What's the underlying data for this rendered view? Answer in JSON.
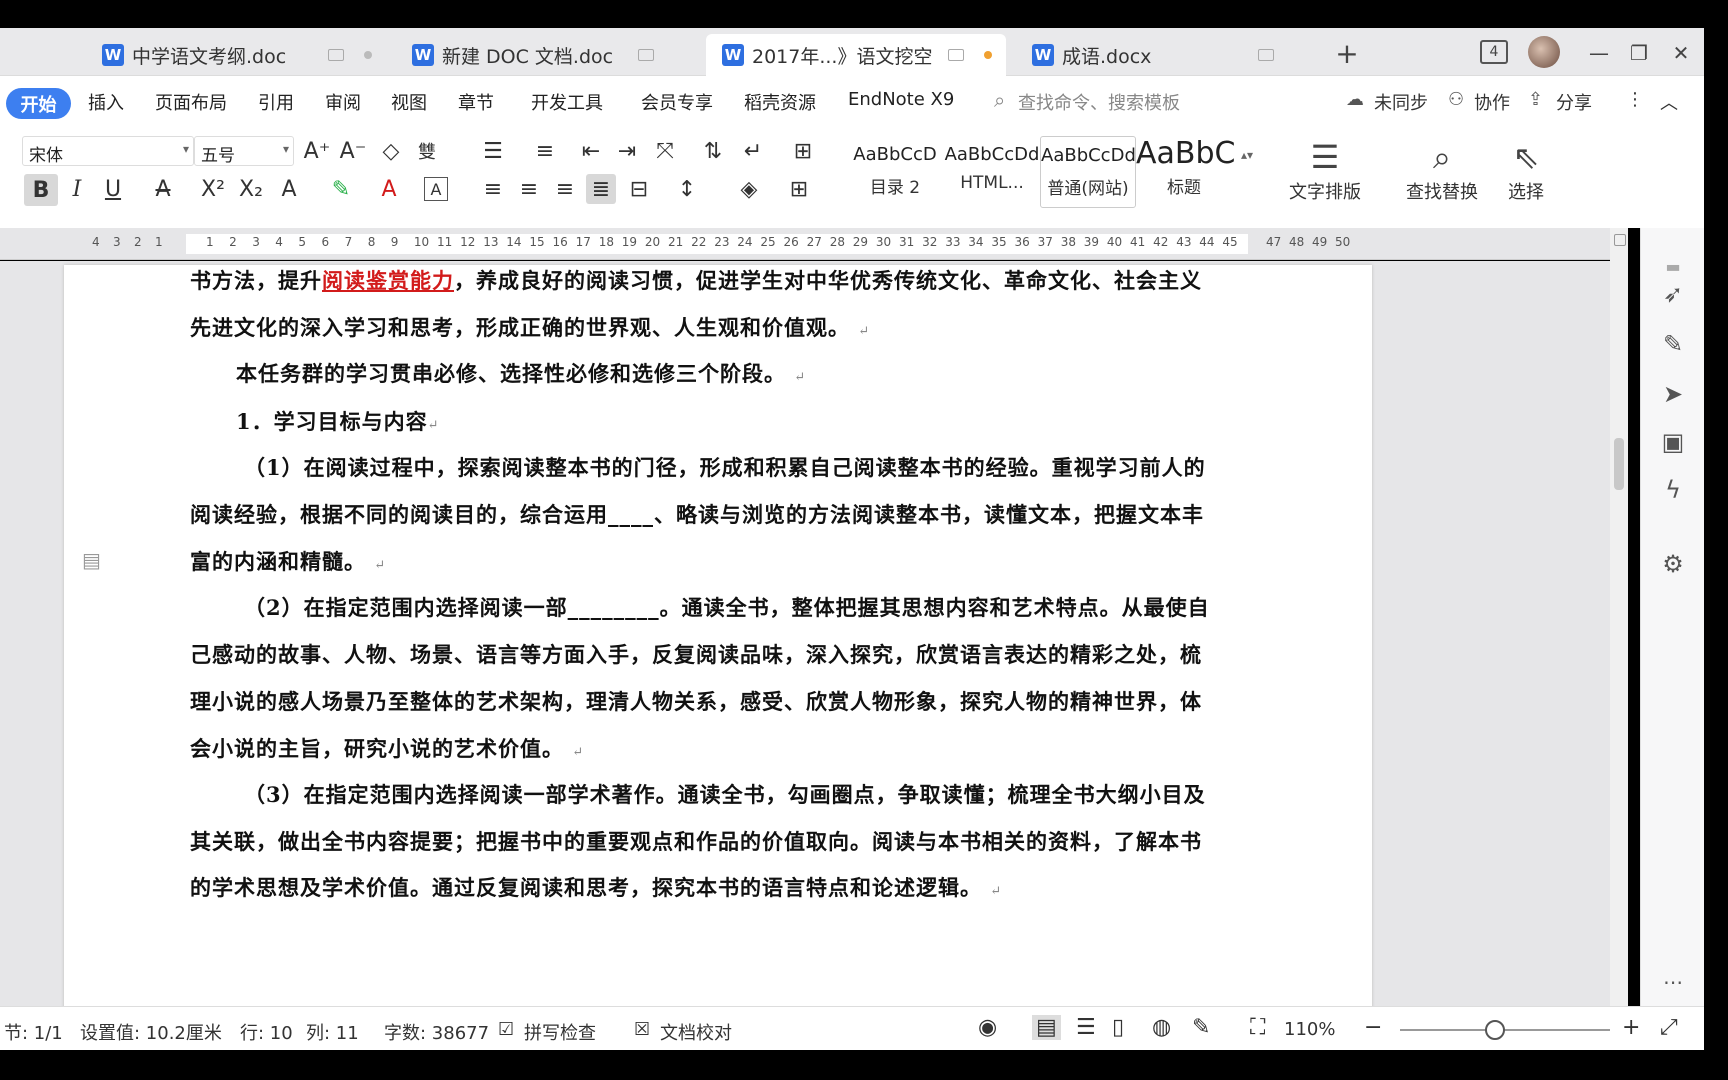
{
  "tabs": [
    {
      "label": "中学语文考纲.doc",
      "active": false,
      "modified": false
    },
    {
      "label": "新建 DOC 文档.doc",
      "active": false,
      "modified": false
    },
    {
      "label": "2017年...》语文挖空",
      "active": true,
      "modified": true
    },
    {
      "label": "成语.docx",
      "active": false,
      "modified": false
    }
  ],
  "window": {
    "new_tab": "+",
    "win_count": "4",
    "min": "—",
    "restore": "❐",
    "close": "✕"
  },
  "menu": {
    "start": "开始",
    "items": [
      "插入",
      "页面布局",
      "引用",
      "审阅",
      "视图",
      "章节",
      "开发工具",
      "会员专享",
      "稻壳资源",
      "EndNote X9"
    ],
    "search_placeholder": "查找命令、搜索模板",
    "sync": "未同步",
    "collab": "协作",
    "share": "分享"
  },
  "toolbar": {
    "font_name": "宋体",
    "font_size": "五号",
    "styles": [
      {
        "preview": "AaBbCcD",
        "label": "目录 2"
      },
      {
        "preview": "AaBbCcDd",
        "label": "HTML..."
      },
      {
        "preview": "AaBbCcDd",
        "label": "普通(网站)"
      },
      {
        "preview": "AaBbC",
        "label": "标题"
      }
    ],
    "typeset": "文字排版",
    "find_replace": "查找替换",
    "select": "选择"
  },
  "ruler": {
    "left_numbers": [
      "4",
      "3",
      "2",
      "1"
    ],
    "right_numbers": [
      "1",
      "2",
      "3",
      "4",
      "5",
      "6",
      "7",
      "8",
      "9",
      "10",
      "11",
      "12",
      "13",
      "14",
      "15",
      "16",
      "17",
      "18",
      "19",
      "20",
      "21",
      "22",
      "23",
      "24",
      "25",
      "26",
      "27",
      "28",
      "29",
      "30",
      "31",
      "32",
      "33",
      "34",
      "35",
      "36",
      "37",
      "38",
      "39",
      "40",
      "41",
      "42",
      "43",
      "44",
      "45"
    ],
    "tail_numbers": [
      "47",
      "48",
      "49",
      "50"
    ]
  },
  "document": {
    "l1a": "书方法，提升",
    "l1hl": "阅读鉴赏能力",
    "l1b": "，养成良好的阅读习惯，促进学生对中华优秀传统文化、革命文化、社会主义",
    "l2": "先进文化的深入学习和思考，形成正确的世界观、人生观和价值观。",
    "l3": "本任务群的学习贯串必修、选择性必修和选修三个阶段。",
    "l4": "1．学习目标与内容",
    "l5": "（1）在阅读过程中，探索阅读整本书的门径，形成和积累自己阅读整本书的经验。重视学习前人的",
    "l6": "阅读经验，根据不同的阅读目的，综合运用____、略读与浏览的方法阅读整本书，读懂文本，把握文本丰",
    "l7": "富的内涵和精髓。",
    "l8": "（2）在指定范围内选择阅读一部________。通读全书，整体把握其思想内容和艺术特点。从最使自",
    "l9": "己感动的故事、人物、场景、语言等方面入手，反复阅读品味，深入探究，欣赏语言表达的精彩之处，梳",
    "l10": "理小说的感人场景乃至整体的艺术架构，理清人物关系，感受、欣赏人物形象，探究人物的精神世界，体",
    "l11": "会小说的主旨，研究小说的艺术价值。",
    "l12": "（3）在指定范围内选择阅读一部学术著作。通读全书，勾画圈点，争取读懂；梳理全书大纲小目及",
    "l13": "其关联，做出全书内容提要；把握书中的重要观点和作品的价值取向。阅读与本书相关的资料，了解本书",
    "l14": "的学术思想及学术价值。通过反复阅读和思考，探究本书的语言特点和论述逻辑。",
    "para_mark": "↵"
  },
  "status": {
    "section": "节: 1/1",
    "setting": "设置值: 10.2厘米",
    "row": "行: 10",
    "col": "列: 11",
    "words": "字数: 38677",
    "spell": "拼写检查",
    "proof": "文档校对",
    "zoom": "110%",
    "zoom_level": 0.45
  }
}
